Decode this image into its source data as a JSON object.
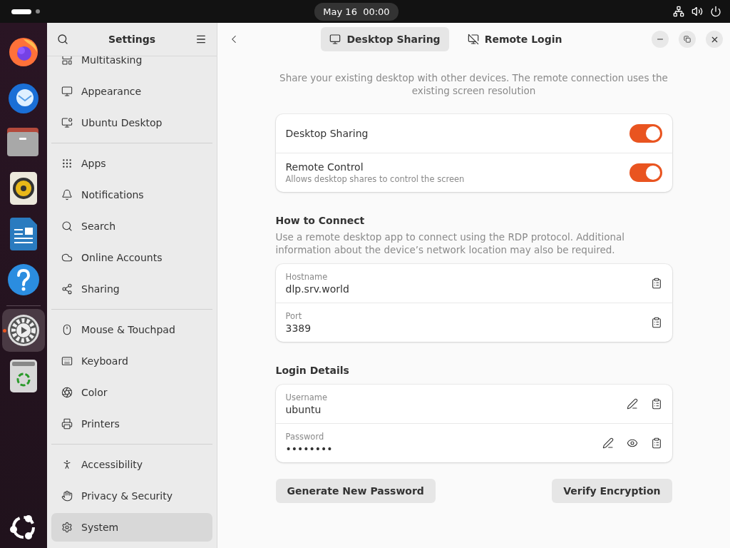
{
  "top_bar": {
    "clock": "May 16  00:00"
  },
  "dock": {
    "items": [
      {
        "kind": "firefox",
        "running": false
      },
      {
        "kind": "mail",
        "running": false
      },
      {
        "kind": "files",
        "running": false
      },
      {
        "kind": "music",
        "running": false
      },
      {
        "kind": "writer",
        "running": false
      },
      {
        "kind": "help",
        "running": false
      },
      {
        "kind": "settings",
        "running": true
      },
      {
        "kind": "trash",
        "running": false
      }
    ]
  },
  "sidebar": {
    "title": "Settings",
    "groups": [
      {
        "items": [
          {
            "kind": "multitasking",
            "label": "Multitasking",
            "selected": false
          },
          {
            "kind": "appearance",
            "label": "Appearance",
            "selected": false
          },
          {
            "kind": "desktop",
            "label": "Ubuntu Desktop",
            "selected": false
          }
        ]
      },
      {
        "items": [
          {
            "kind": "apps",
            "label": "Apps",
            "selected": false
          },
          {
            "kind": "notifications",
            "label": "Notifications",
            "selected": false
          },
          {
            "kind": "search",
            "label": "Search",
            "selected": false
          },
          {
            "kind": "accounts",
            "label": "Online Accounts",
            "selected": false
          },
          {
            "kind": "sharing",
            "label": "Sharing",
            "selected": false
          }
        ]
      },
      {
        "items": [
          {
            "kind": "mouse",
            "label": "Mouse & Touchpad",
            "selected": false
          },
          {
            "kind": "keyboard",
            "label": "Keyboard",
            "selected": false
          },
          {
            "kind": "color",
            "label": "Color",
            "selected": false
          },
          {
            "kind": "printers",
            "label": "Printers",
            "selected": false
          }
        ]
      },
      {
        "items": [
          {
            "kind": "accessibility",
            "label": "Accessibility",
            "selected": false
          },
          {
            "kind": "privacy",
            "label": "Privacy & Security",
            "selected": false
          },
          {
            "kind": "system",
            "label": "System",
            "selected": true
          }
        ]
      }
    ]
  },
  "tabs": [
    {
      "kind": "desktop",
      "label": "Desktop Sharing",
      "selected": true
    },
    {
      "kind": "remote",
      "label": "Remote Login",
      "selected": false
    }
  ],
  "description": "Share your existing desktop with other devices. The remote connection uses the existing screen resolution",
  "toggles": [
    {
      "title": "Desktop Sharing",
      "on": true
    },
    {
      "title": "Remote Control",
      "subtitle": "Allows desktop shares to control the screen",
      "on": true
    }
  ],
  "how_to_connect": {
    "heading": "How to Connect",
    "text": "Use a remote desktop app to connect using the RDP protocol. Additional information about the device’s network location may also be required.",
    "fields": [
      {
        "label": "Hostname",
        "value": "dlp.srv.world",
        "actions": [
          {
            "kind": "copy"
          }
        ]
      },
      {
        "label": "Port",
        "value": "3389",
        "actions": [
          {
            "kind": "copy"
          }
        ]
      }
    ]
  },
  "login_details": {
    "heading": "Login Details",
    "fields": [
      {
        "label": "Username",
        "value": "ubuntu",
        "actions": [
          {
            "kind": "edit"
          },
          {
            "kind": "copy"
          }
        ]
      },
      {
        "label": "Password",
        "value": "••••••••",
        "actions": [
          {
            "kind": "edit"
          },
          {
            "kind": "reveal"
          },
          {
            "kind": "copy"
          }
        ]
      }
    ]
  },
  "buttons": [
    "Generate New Password",
    "Verify Encryption"
  ]
}
